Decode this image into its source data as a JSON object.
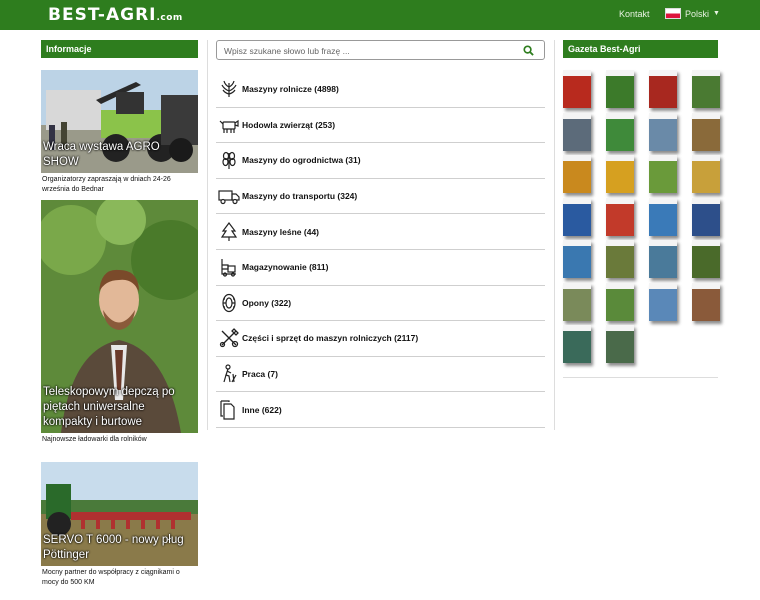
{
  "header": {
    "logo_main": "BEST-AGRI",
    "logo_suffix": ".com",
    "kontakt": "Kontakt",
    "language": "Polski"
  },
  "left": {
    "title": "Informacje",
    "news": [
      {
        "headline": "Wraca wystawa AGRO SHOW",
        "caption": "Organizatorzy zapraszają w dniach 24-26 września do Bednar"
      },
      {
        "headline": "Teleskopowym depczą po piętach uniwersalne kompakty i burtowe",
        "caption": "Najnowsze ładowarki dla rolników"
      },
      {
        "headline": "SERVO T 6000 - nowy pług Pöttinger",
        "caption": "Mocny partner do współpracy z ciągnikami o mocy do 500 KM"
      }
    ]
  },
  "search": {
    "placeholder": "Wpisz szukane słowo lub frazę ..."
  },
  "categories": [
    {
      "label": "Maszyny rolnicze (4898)",
      "icon": "wheat-icon"
    },
    {
      "label": "Hodowla zwierząt (253)",
      "icon": "livestock-icon"
    },
    {
      "label": "Maszyny do ogrodnictwa (31)",
      "icon": "plant-icon"
    },
    {
      "label": "Maszyny do transportu (324)",
      "icon": "truck-icon"
    },
    {
      "label": "Maszyny leśne (44)",
      "icon": "tree-icon"
    },
    {
      "label": "Magazynowanie (811)",
      "icon": "forklift-icon"
    },
    {
      "label": "Opony (322)",
      "icon": "tire-icon"
    },
    {
      "label": "Części i sprzęt do maszyn rolniczych (2117)",
      "icon": "tools-icon"
    },
    {
      "label": "Praca (7)",
      "icon": "worker-icon"
    },
    {
      "label": "Inne (622)",
      "icon": "documents-icon"
    }
  ],
  "right": {
    "title": "Gazeta Best-Agri",
    "covers": [
      "#b82a1e",
      "#3c7a2a",
      "#a8281f",
      "#4a7a32",
      "#5c6b7a",
      "#3f8a3a",
      "#6a8aa8",
      "#8a6a3a",
      "#c9891e",
      "#d6a020",
      "#6a9a3a",
      "#c8a03a",
      "#2a5aa0",
      "#c23a2a",
      "#3a7ab8",
      "#2d4f8a",
      "#3a78b0",
      "#6a7a3a",
      "#4a7a9a",
      "#4a6a2a",
      "#7a8a5a",
      "#5a8a3a",
      "#5a88b8",
      "#8a5a3a",
      "#3a6a5a",
      "#4a6a4a"
    ]
  }
}
